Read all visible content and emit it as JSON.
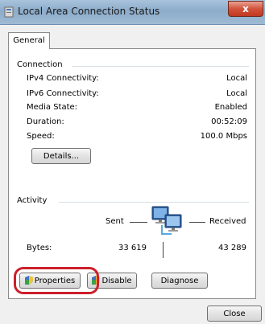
{
  "window": {
    "title": "Local Area Connection Status",
    "close_glyph": "x"
  },
  "tabs": [
    "General"
  ],
  "connection": {
    "group_label": "Connection",
    "rows": [
      {
        "label": "IPv4 Connectivity:",
        "value": "Local"
      },
      {
        "label": "IPv6 Connectivity:",
        "value": "Local"
      },
      {
        "label": "Media State:",
        "value": "Enabled"
      },
      {
        "label": "Duration:",
        "value": "00:52:09"
      },
      {
        "label": "Speed:",
        "value": "100.0 Mbps"
      }
    ],
    "details_button": "Details..."
  },
  "activity": {
    "group_label": "Activity",
    "sent_label": "Sent",
    "received_label": "Received",
    "bytes_label": "Bytes:",
    "bytes_sent": "33 619",
    "bytes_received": "43 289"
  },
  "buttons": {
    "properties": "Properties",
    "disable": "Disable",
    "diagnose": "Diagnose",
    "close": "Close"
  },
  "colors": {
    "highlight": "#cc1f2a",
    "title_bar": "#9fbad4"
  }
}
